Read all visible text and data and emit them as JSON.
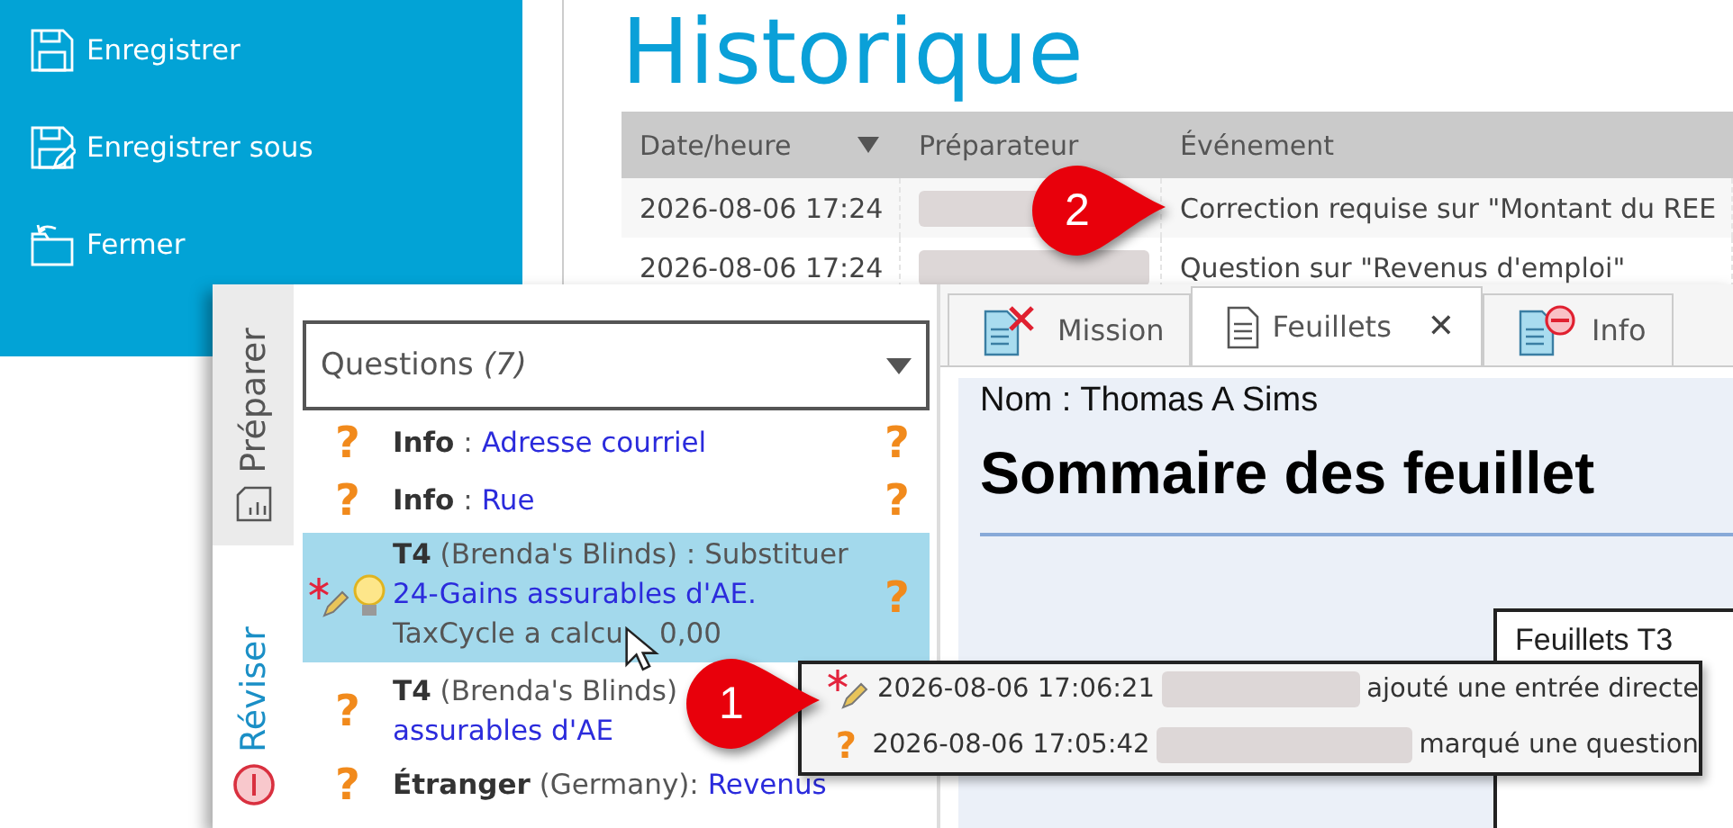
{
  "sidebar": {
    "items": [
      {
        "label": "Enregistrer",
        "kind": "save"
      },
      {
        "label": "Enregistrer sous",
        "kind": "save-as"
      },
      {
        "label": "Fermer",
        "kind": "close"
      }
    ]
  },
  "history": {
    "title": "Historique",
    "columns": [
      {
        "label": "Date/heure",
        "sorted": true
      },
      {
        "label": "Préparateur",
        "sorted": false
      },
      {
        "label": "Événement",
        "sorted": false
      }
    ],
    "rows": [
      {
        "date": "2026-08-06 17:24",
        "event": "Correction requise sur \"Montant du REE"
      },
      {
        "date": "2026-08-06 17:24",
        "event": "Question sur \"Revenus d'emploi\""
      }
    ]
  },
  "review_window": {
    "side_tabs": [
      {
        "label": "Préparer",
        "kind": "prepare",
        "selected": false
      },
      {
        "label": "Réviser",
        "kind": "review",
        "selected": true
      }
    ],
    "filter": {
      "value": "Questions",
      "count": "(7)"
    },
    "questions": [
      {
        "kind": "question",
        "selected": false,
        "marker": "?",
        "form": "Info",
        "context": ":",
        "link": "Adresse courriel",
        "flag": "?"
      },
      {
        "kind": "question",
        "selected": false,
        "marker": "?",
        "form": "Info",
        "context": ":",
        "link": "Rue",
        "flag": "?"
      },
      {
        "kind": "edited",
        "selected": true,
        "form": "T4",
        "context": "(Brenda's Blinds) : Substituer",
        "link": "24-Gains assurables d'AE.",
        "tail": "TaxCycle a calcu",
        "tail_end": "0,00",
        "flag": "?"
      },
      {
        "kind": "question",
        "selected": false,
        "marker": "?",
        "form": "T4",
        "context": "(Brenda's Blinds)",
        "link": "assurables d'AE"
      },
      {
        "kind": "question",
        "selected": false,
        "marker": "?",
        "form": "Étranger",
        "context": "(Germany):",
        "link": "Revenus"
      }
    ],
    "doc_tabs": [
      {
        "label": "Mission",
        "kind": "mission",
        "selected": false
      },
      {
        "label": "Feuillets",
        "kind": "slips",
        "selected": true,
        "close": "✕"
      },
      {
        "label": "Info",
        "kind": "info",
        "selected": false
      }
    ],
    "document": {
      "name_line": "Nom : Thomas A Sims",
      "heading": "Sommaire des feuillet",
      "box_lines": [
        "Feuillets T3"
      ]
    },
    "tooltip": {
      "rows": [
        {
          "kind": "edited",
          "time": "2026-08-06 17:06:21",
          "action": "ajouté une entrée directe"
        },
        {
          "kind": "question",
          "marker": "?",
          "time": "2026-08-06 17:05:42",
          "action": "marqué une question"
        }
      ]
    }
  },
  "callouts": [
    {
      "number": "2"
    },
    {
      "number": "1"
    }
  ]
}
